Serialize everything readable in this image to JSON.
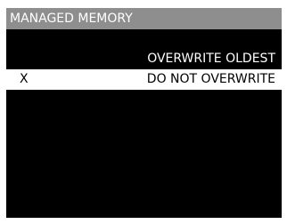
{
  "header": {
    "title": "MANAGED MEMORY"
  },
  "options": [
    {
      "marker": "",
      "label": "OVERWRITE OLDEST",
      "selected": false
    },
    {
      "marker": "X",
      "label": "DO NOT OVERWRITE",
      "selected": true
    }
  ],
  "colors": {
    "background": "#000000",
    "title_bar": "#8e8e8e",
    "text": "#ffffff",
    "highlight": "#ffffff",
    "highlight_text": "#000000"
  }
}
